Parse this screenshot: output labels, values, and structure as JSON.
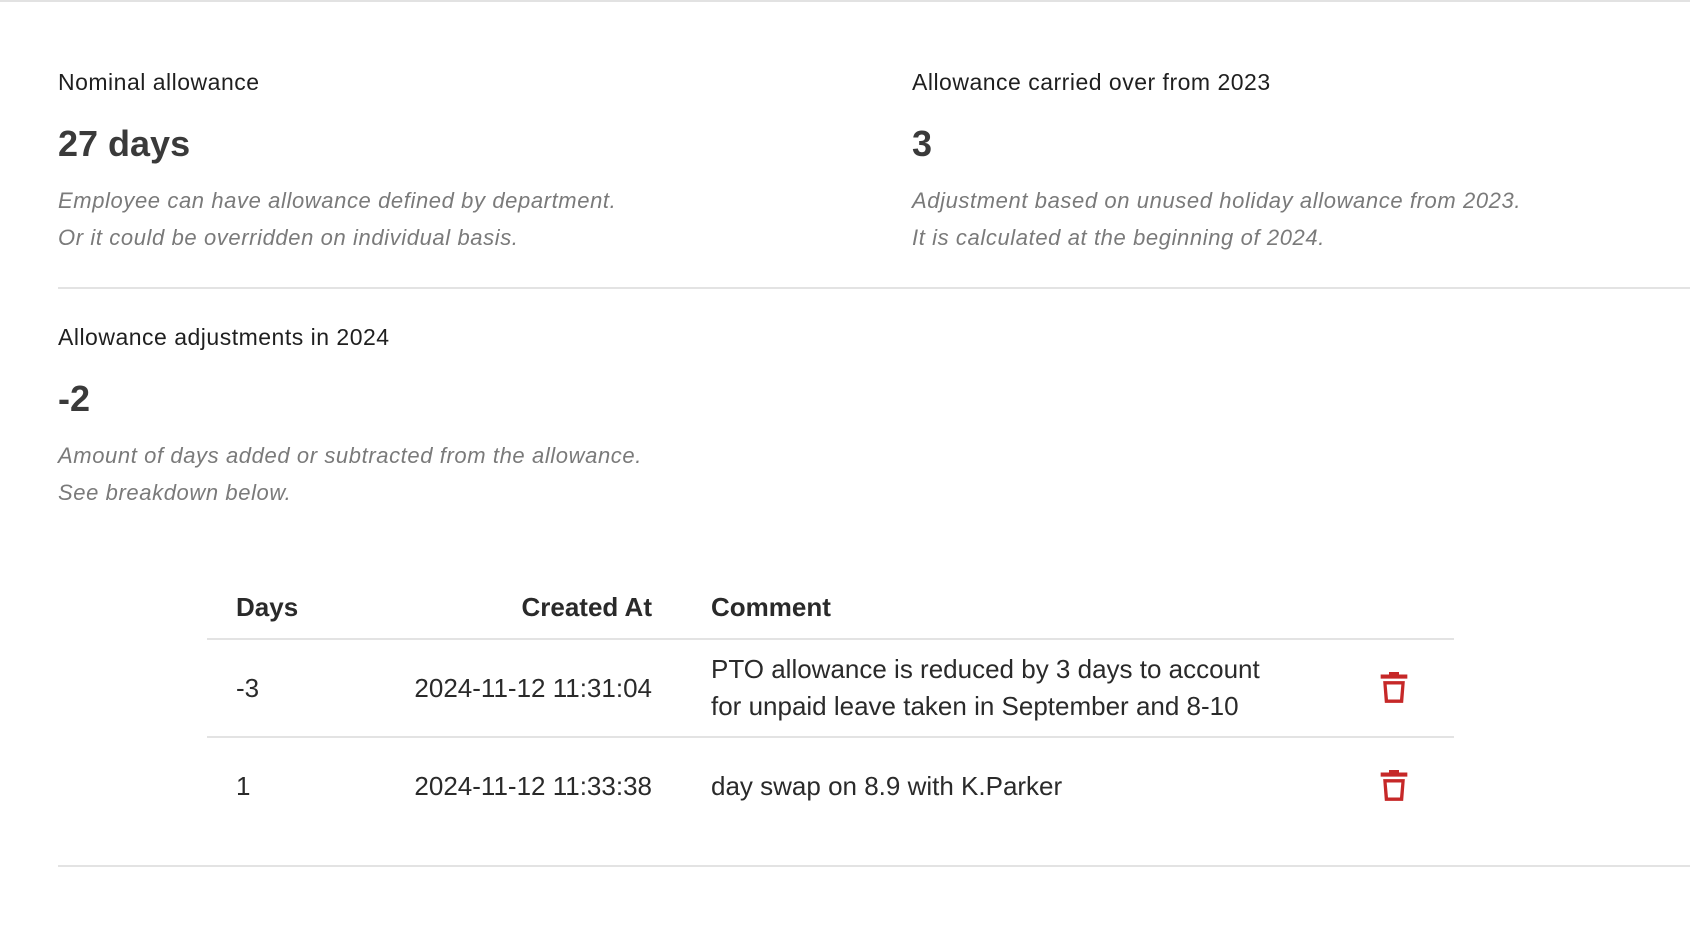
{
  "nominal": {
    "label": "Nominal allowance",
    "value": "27 days",
    "hint_line1": "Employee can have allowance defined by department.",
    "hint_line2": "Or it could be overridden on individual basis."
  },
  "carried_over": {
    "label": "Allowance carried over from 2023",
    "value": "3",
    "hint_line1": "Adjustment based on unused holiday allowance from 2023.",
    "hint_line2": "It is calculated at the beginning of 2024."
  },
  "adjustments": {
    "label": "Allowance adjustments in 2024",
    "value": "-2",
    "hint_line1": "Amount of days added or subtracted from the allowance.",
    "hint_line2": "See breakdown below."
  },
  "table": {
    "headers": {
      "days": "Days",
      "created_at": "Created At",
      "comment": "Comment"
    },
    "rows": [
      {
        "days": "-3",
        "created_at": "2024-11-12 11:31:04",
        "comment_line1": "PTO allowance is reduced by 3 days to account",
        "comment_line2": "for unpaid leave taken in September and 8-10"
      },
      {
        "days": "1",
        "created_at": "2024-11-12 11:33:38",
        "comment_line1": "day swap on 8.9 with K.Parker",
        "comment_line2": ""
      }
    ]
  },
  "colors": {
    "delete_icon": "#c62828",
    "divider": "#e3e3e3",
    "hint_text": "#7a7a7a"
  },
  "icons": {
    "delete": "trash-icon"
  }
}
